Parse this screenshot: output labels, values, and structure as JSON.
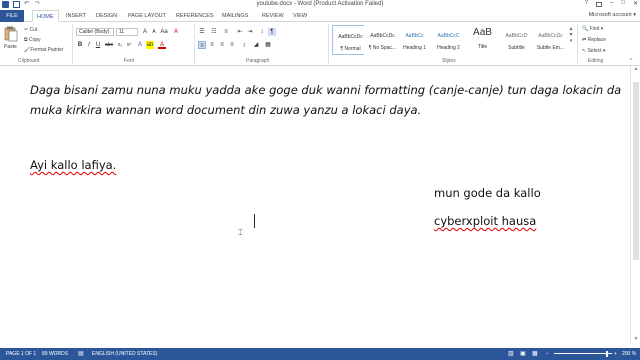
{
  "title_bar": {
    "title": "youtube.docx - Word (Product Activation Failed)",
    "help": "?",
    "minimize": "–",
    "restore": "□",
    "close": "✕"
  },
  "tabs": {
    "file": "FILE",
    "items": [
      "HOME",
      "INSERT",
      "DESIGN",
      "PAGE LAYOUT",
      "REFERENCES",
      "MAILINGS",
      "REVIEW",
      "VIEW"
    ],
    "account": "Microsoft account"
  },
  "ribbon": {
    "clipboard": {
      "paste": "Paste",
      "cut": "Cut",
      "copy": "Copy",
      "format_painter": "Format Painter",
      "label": "Clipboard"
    },
    "font": {
      "font_name": "Calibri (Body)",
      "font_size": "11",
      "label": "Font"
    },
    "paragraph": {
      "label": "Paragraph"
    },
    "styles": {
      "label": "Styles",
      "items": [
        {
          "sample": "AaBbCcDc",
          "name": "¶ Normal"
        },
        {
          "sample": "AaBbCcDc",
          "name": "¶ No Spac..."
        },
        {
          "sample": "AaBbCc",
          "name": "Heading 1"
        },
        {
          "sample": "AaBbCcC",
          "name": "Heading 2"
        },
        {
          "sample": "AaB",
          "name": "Title"
        },
        {
          "sample": "AaBbCcD",
          "name": "Subtitle"
        },
        {
          "sample": "AaBbCcDc",
          "name": "Subtle Em..."
        }
      ]
    },
    "editing": {
      "find": "Find",
      "replace": "Replace",
      "select": "Select",
      "label": "Editing"
    }
  },
  "document": {
    "line1": "Daga bisani zamu nuna muku yadda ake goge duk wanni formatting (canje-canje) tun daga lokacin da",
    "line2": "muka kirkira wannan word document din zuwa yanzu a lokaci daya.",
    "greeting": "Ayi kallo lafiya.",
    "closing": "mun gode da kallo",
    "signature": "cyberxploit hausa"
  },
  "status_bar": {
    "page": "PAGE 1 OF 1",
    "words": "89 WORDS",
    "language": "ENGLISH (UNITED STATES)",
    "zoom": "200 %"
  },
  "colors": {
    "accent": "#2b579a",
    "spell_error": "#d00000"
  }
}
